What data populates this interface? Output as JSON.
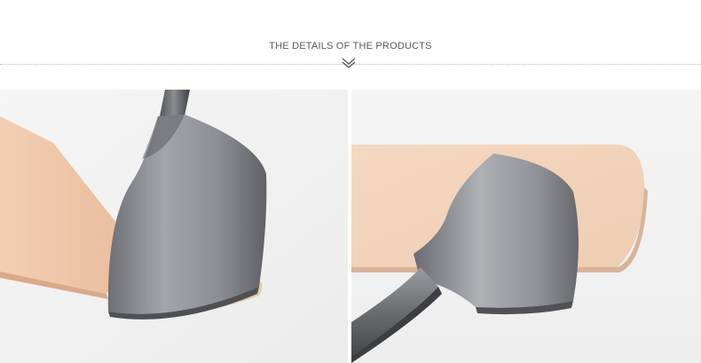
{
  "header": {
    "title": "THE DETAILS OF THE PRODUCTS",
    "chevron_icon": "double-chevron-down-icon"
  },
  "images": [
    {
      "name": "product-photo-left",
      "subject": "steel strap-end punch on leather strip"
    },
    {
      "name": "product-photo-right",
      "subject": "steel round-end punch on leather piece"
    }
  ],
  "colors": {
    "leather": "#f0c9ab",
    "leather_light": "#f6dbc4",
    "steel": "#8f9094",
    "background": "#f2f2f2"
  }
}
